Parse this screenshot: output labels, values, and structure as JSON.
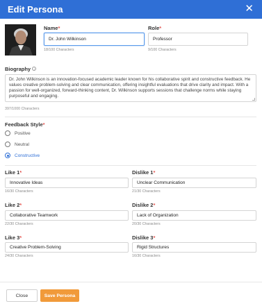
{
  "header": {
    "title": "Edit Persona",
    "close_glyph": "✕"
  },
  "name": {
    "label": "Name",
    "value": "Dr. John Wilkinson",
    "count": "18/100 Characters"
  },
  "role": {
    "label": "Role",
    "value": "Professor",
    "count": "9/100 Characters"
  },
  "biography": {
    "label": "Biography",
    "info_glyph": "i",
    "value": "Dr. John Wilkinson is an innovation-focused academic leader known for his collaborative spirit and constructive feedback. He values creative problem-solving and clear communication, offering insightful evaluations that drive clarity and impact. With a passion for well-organized, forward-thinking content, Dr. Wilkinson supports sessions that challenge norms while staying purposeful and engaging.",
    "count": "397/1000 Characters"
  },
  "feedback": {
    "label": "Feedback Style",
    "options": [
      "Positive",
      "Neutral",
      "Constructive"
    ],
    "selected": "Constructive"
  },
  "likes": [
    {
      "label": "Like 1",
      "value": "Innovative Ideas",
      "count": "16/30 Characters"
    },
    {
      "label": "Like 2",
      "value": "Collaborative Teamwork",
      "count": "22/30 Characters"
    },
    {
      "label": "Like 3",
      "value": "Creative Problem-Solving",
      "count": "24/30 Characters"
    }
  ],
  "dislikes": [
    {
      "label": "Dislike 1",
      "value": "Unclear Communication",
      "count": "21/30 Characters"
    },
    {
      "label": "Dislike 2",
      "value": "Lack of Organization",
      "count": "20/30 Characters"
    },
    {
      "label": "Dislike 3",
      "value": "Rigid Structures",
      "count": "16/30 Characters"
    }
  ],
  "required_mark": "*",
  "footer": {
    "close_label": "Close",
    "save_label": "Save Persona"
  },
  "colors": {
    "accent": "#2f6fd6",
    "save": "#f19a3a",
    "required": "#e2554f"
  }
}
